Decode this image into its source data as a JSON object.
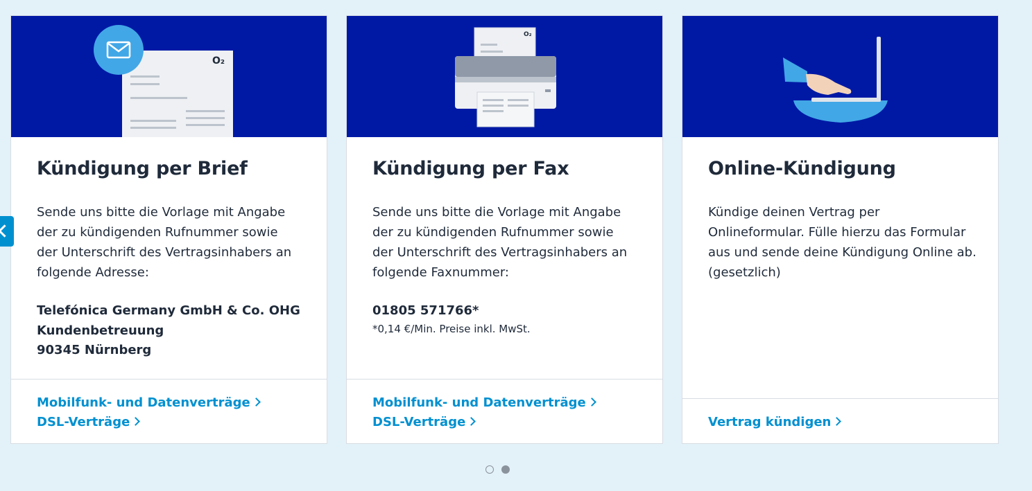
{
  "carousel": {
    "prev_icon": "chevron-left-icon",
    "dots": [
      {
        "active": false
      },
      {
        "active": true
      }
    ]
  },
  "cards": [
    {
      "illustration": "letter-envelope-illustration",
      "title": "Kündigung per Brief",
      "text": "Sende uns bitte die Vorlage mit Angabe der zu kündigenden Rufnummer sowie der Unterschrift des Vertragsinhabers an folgende Adresse:",
      "address": [
        "Telefónica Germany GmbH & Co. OHG",
        "Kundenbetreuung",
        "90345 Nürnberg"
      ],
      "links": [
        "Mobilfunk- und Datenverträge",
        "DSL-Verträge"
      ],
      "logo_text": "O₂"
    },
    {
      "illustration": "fax-machine-illustration",
      "title": "Kündigung per Fax",
      "text": "Sende uns bitte die Vorlage mit Angabe der zu kündigenden Rufnummer sowie der Unterschrift des Vertragsinhabers an folgende Faxnummer:",
      "fax_number": "01805 571766*",
      "fax_note": "*0,14 €/Min. Preise inkl. MwSt.",
      "links": [
        "Mobilfunk- und Datenverträge",
        "DSL-Verträge"
      ],
      "logo_text": "O₂"
    },
    {
      "illustration": "laptop-hand-illustration",
      "title": "Online-Kündigung",
      "text": "Kündige deinen Vertrag per Onlineformular. Fülle hierzu das Formular aus und sende deine Kündigung Online ab. (gesetzlich)",
      "links": [
        "Vertrag kündigen"
      ]
    }
  ],
  "colors": {
    "banner": "#0019a5",
    "link": "#0090d0",
    "page_bg": "#e3f1f9"
  }
}
